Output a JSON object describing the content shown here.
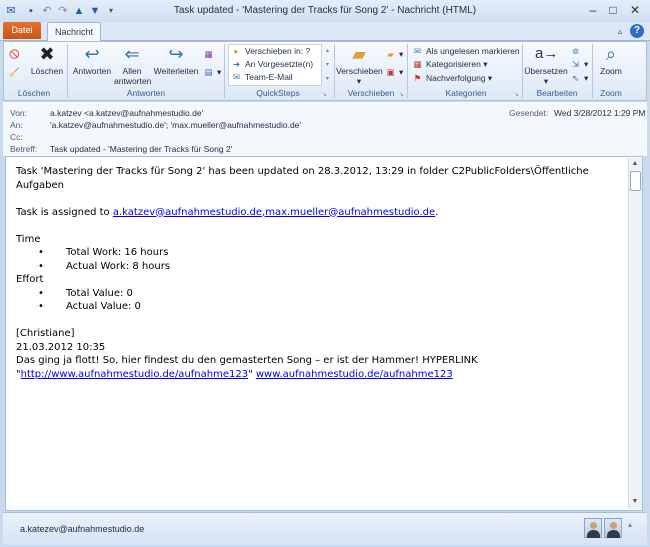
{
  "window": {
    "title": "Task updated - 'Mastering der Tracks für Song 2'  -  Nachricht (HTML)",
    "minimize": "–",
    "maximize": "□",
    "close": "✕"
  },
  "tabs": {
    "datei": "Datei",
    "nachricht": "Nachricht"
  },
  "ribbon": {
    "loeschen": {
      "delete": "Löschen",
      "group": "Löschen"
    },
    "antworten": {
      "reply": "Antworten",
      "reply_all_1": "Allen",
      "reply_all_2": "antworten",
      "forward": "Weiterleiten",
      "group": "Antworten"
    },
    "quicksteps": {
      "items": [
        "Verschieben in: ?",
        "An Vorgesetzte(n)",
        "Team-E-Mail"
      ],
      "group": "QuickSteps"
    },
    "verschieben": {
      "move": "Verschieben",
      "group": "Verschieben"
    },
    "kategorien": {
      "items": [
        "Als ungelesen markieren",
        "Kategorisieren",
        "Nachverfolgung"
      ],
      "group": "Kategorien"
    },
    "bearbeiten": {
      "translate": "Übersetzen",
      "group": "Bearbeiten"
    },
    "zoom": {
      "zoom": "Zoom",
      "group": "Zoom"
    }
  },
  "header": {
    "from_label": "Von:",
    "from_value": "a.katzev <a.katzev@aufnahmestudio.de'",
    "sent_label": "Gesendet:",
    "sent_value": "Wed 3/28/2012 1:29 PM",
    "to_label": "An:",
    "to_value": "'a.katzev@aufnahmestudio.de'; 'max.mueller@aufnahmestudio.de'",
    "cc_label": "Cc:",
    "cc_value": "",
    "subject_label": "Betreff:",
    "subject_value": "Task updated - 'Mastering der Tracks für Song 2'"
  },
  "body": {
    "line1": "Task 'Mastering der Tracks für Song 2' has been updated on 28.3.2012, 13:29 in folder C2PublicFolders\\Öffentliche Aufgaben",
    "assigned_prefix": "Task is assigned to ",
    "assigned_link": "a.katzev@aufnahmestudio.de,max.mueller@aufnahmestudio.de",
    "assigned_suffix": ".",
    "time_heading": "Time",
    "time_items": [
      "Total Work: 16 hours",
      "Actual Work: 8 hours"
    ],
    "effort_heading": "Effort",
    "effort_items": [
      "Total Value: 0",
      "Actual Value: 0"
    ],
    "comment_author": "[Christiane]",
    "comment_date": "21.03.2012 10:35",
    "comment_text": "Das ging ja flott! So, hier findest du den gemasterten Song – er ist der Hammer!  HYPERLINK",
    "comment_quote_open": "\"",
    "comment_link1": "http://www.aufnahmestudio.de/aufnahme123",
    "comment_quote_close": "\" ",
    "comment_link2": "www.aufnahmestudio.de/aufnahme123"
  },
  "footer": {
    "name": "a.katezev@aufnahmestudio.de"
  }
}
